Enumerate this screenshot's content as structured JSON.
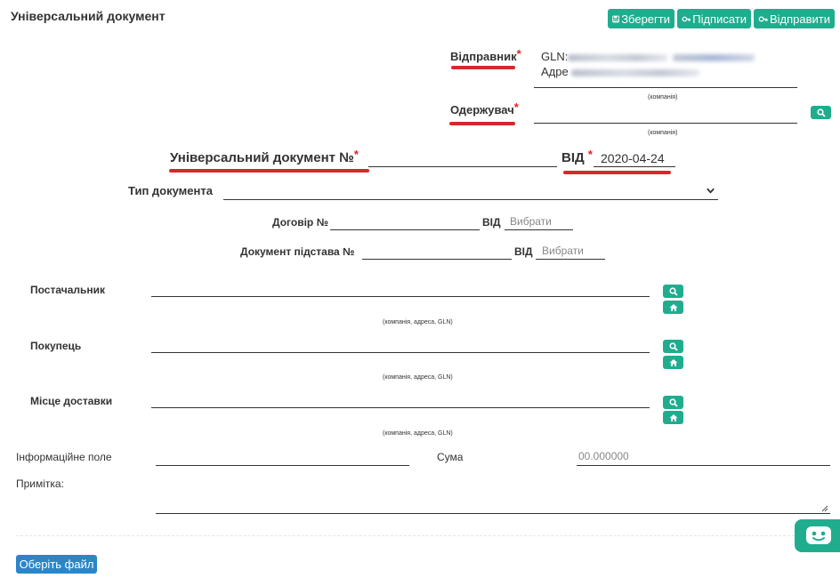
{
  "header": {
    "title": "Універсальний документ",
    "save_label": "Зберегти",
    "sign_label": "Підписати",
    "send_label": "Відправити"
  },
  "sender": {
    "label": "Відправник",
    "gln_prefix": "GLN:",
    "address_prefix": "Адре",
    "caption": "(компанія)"
  },
  "receiver": {
    "label": "Одержувач",
    "caption": "(компанія)"
  },
  "document": {
    "number_label": "Універсальний документ №",
    "date_label": "ВІД",
    "date_value": "2020-04-24",
    "type_label": "Тип документа",
    "contract_label": "Договір №",
    "contract_date_label": "ВІД",
    "contract_date_placeholder": "Вибрати",
    "basis_label": "Документ підстава №",
    "basis_date_label": "ВІД",
    "basis_date_placeholder": "Вибрати"
  },
  "parties": [
    {
      "label": "Постачальник",
      "caption": "(компанія, адреса, GLN)"
    },
    {
      "label": "Покупець",
      "caption": "(компанія, адреса, GLN)"
    },
    {
      "label": "Місце доставки",
      "caption": "(компанія, адреса, GLN)"
    }
  ],
  "footer": {
    "info_label": "Інформаційне поле",
    "sum_label": "Сума",
    "sum_placeholder": "00.000000",
    "note_label": "Примітка:",
    "upload_label": "Оберіть файл"
  },
  "colors": {
    "accent": "#1fad8e",
    "upload": "#2a86c8",
    "required": "#e02020",
    "highlight": "#d9262c"
  },
  "icons": {
    "save": "floppy-icon",
    "sign": "key-icon",
    "send": "key-icon",
    "search": "search-icon",
    "home": "home-icon",
    "chat": "chat-bot-icon"
  }
}
